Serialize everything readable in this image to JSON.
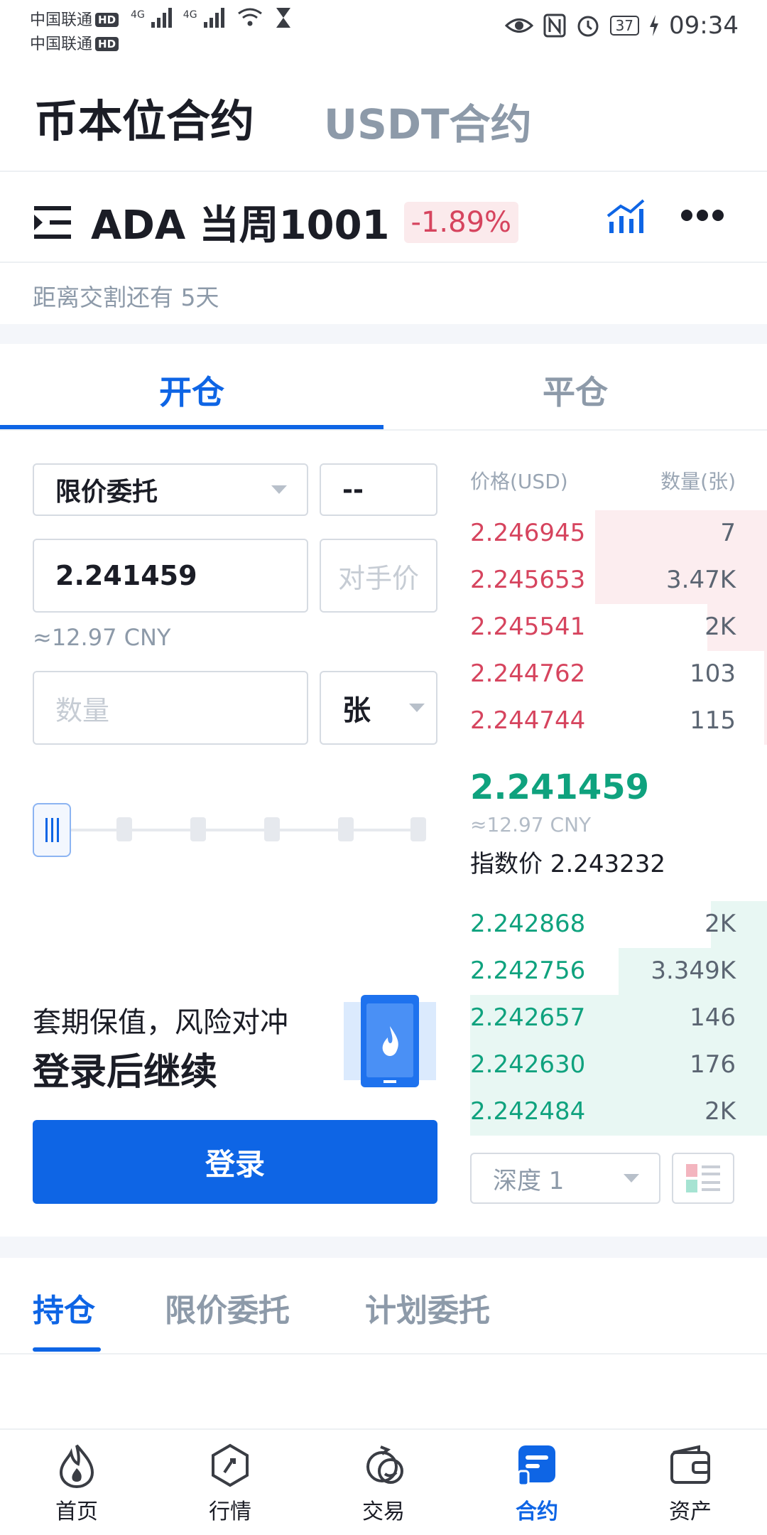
{
  "status_bar": {
    "carrier1": "中国联通",
    "carrier2": "中国联通",
    "hd": "HD",
    "net": "4G",
    "battery": "37",
    "time": "09:34"
  },
  "header": {
    "tab_active": "币本位合约",
    "tab_inactive": "USDT合约"
  },
  "pair": {
    "name": "ADA 当周1001",
    "change": "-1.89%",
    "delivery": "距离交割还有 5天"
  },
  "trade_tabs": {
    "open": "开仓",
    "close": "平仓"
  },
  "form": {
    "order_type": "限价委托",
    "leverage": "--",
    "price": "2.241459",
    "counter_price": "对手价",
    "price_cny": "≈12.97 CNY",
    "qty_placeholder": "数量",
    "unit": "张",
    "hedge_text": "套期保值，风险对冲",
    "login_cta": "登录后继续",
    "login_button": "登录"
  },
  "orderbook": {
    "price_header": "价格(USD)",
    "qty_header": "数量(张)",
    "asks": [
      {
        "price": "2.246945",
        "qty": "7",
        "depth": 0.58
      },
      {
        "price": "2.245653",
        "qty": "3.47K",
        "depth": 0.58
      },
      {
        "price": "2.245541",
        "qty": "2K",
        "depth": 0.2
      },
      {
        "price": "2.244762",
        "qty": "103",
        "depth": 0.01
      },
      {
        "price": "2.244744",
        "qty": "115",
        "depth": 0.01
      }
    ],
    "last_price": "2.241459",
    "last_cny": "≈12.97 CNY",
    "index_price": "指数价 2.243232",
    "bids": [
      {
        "price": "2.242868",
        "qty": "2K",
        "depth": 0.19
      },
      {
        "price": "2.242756",
        "qty": "3.349K",
        "depth": 0.5
      },
      {
        "price": "2.242657",
        "qty": "146",
        "depth": 1.0
      },
      {
        "price": "2.242630",
        "qty": "176",
        "depth": 1.0
      },
      {
        "price": "2.242484",
        "qty": "2K",
        "depth": 1.0
      }
    ],
    "depth_label": "深度 1"
  },
  "positions_tabs": [
    "持仓",
    "限价委托",
    "计划委托"
  ],
  "nav": [
    {
      "label": "首页",
      "icon": "flame-icon"
    },
    {
      "label": "行情",
      "icon": "market-icon"
    },
    {
      "label": "交易",
      "icon": "exchange-icon"
    },
    {
      "label": "合约",
      "icon": "contract-icon"
    },
    {
      "label": "资产",
      "icon": "wallet-icon"
    }
  ],
  "colors": {
    "accent": "#0e65e5",
    "ask": "#d6445e",
    "bid": "#0fa27e",
    "muted": "#8d9aa9"
  }
}
